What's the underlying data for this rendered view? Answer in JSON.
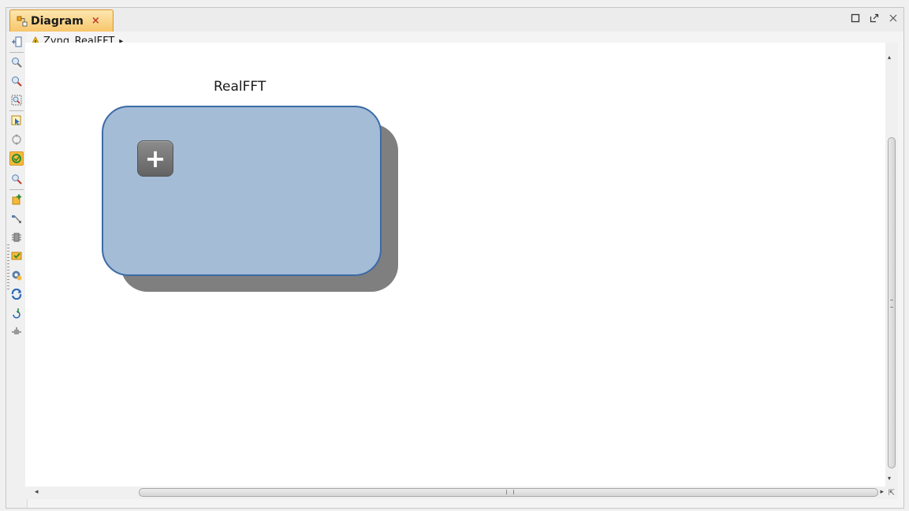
{
  "tab": {
    "label": "Diagram",
    "close": "×",
    "icon": "diagram-icon"
  },
  "window_controls": [
    {
      "name": "maximize-icon"
    },
    {
      "name": "restore-icon"
    },
    {
      "name": "close-window-icon"
    }
  ],
  "breadcrumb": {
    "label": "Zynq_RealFFT",
    "arrow": "▸",
    "icon": "warning-icon"
  },
  "toolbar": {
    "tools": [
      "fit-view-icon",
      "zoom-in-icon",
      "zoom-out-icon",
      "zoom-fit-icon",
      "select-icon",
      "regenerate-layout-icon",
      "validate-design-icon",
      "search-icon",
      "add-ip-icon",
      "make-connection-icon",
      "add-module-icon",
      "run-automation-icon",
      "settings-icon",
      "refresh-icon",
      "rotate-icon",
      "port-icon"
    ],
    "active_tool": "validate-design-icon"
  },
  "diagram": {
    "block_title": "RealFFT",
    "expand_label": "+"
  },
  "scrollbars": {
    "vertical_up": "▴",
    "vertical_down": "▾",
    "horizontal_left": "◂",
    "horizontal_right": "▸",
    "corner": "⇱"
  },
  "colors": {
    "accent": "#f7c66b",
    "block_fill": "#a4bcd6",
    "block_border": "#3b6ba6",
    "block_shadow": "#7f7f7f"
  }
}
